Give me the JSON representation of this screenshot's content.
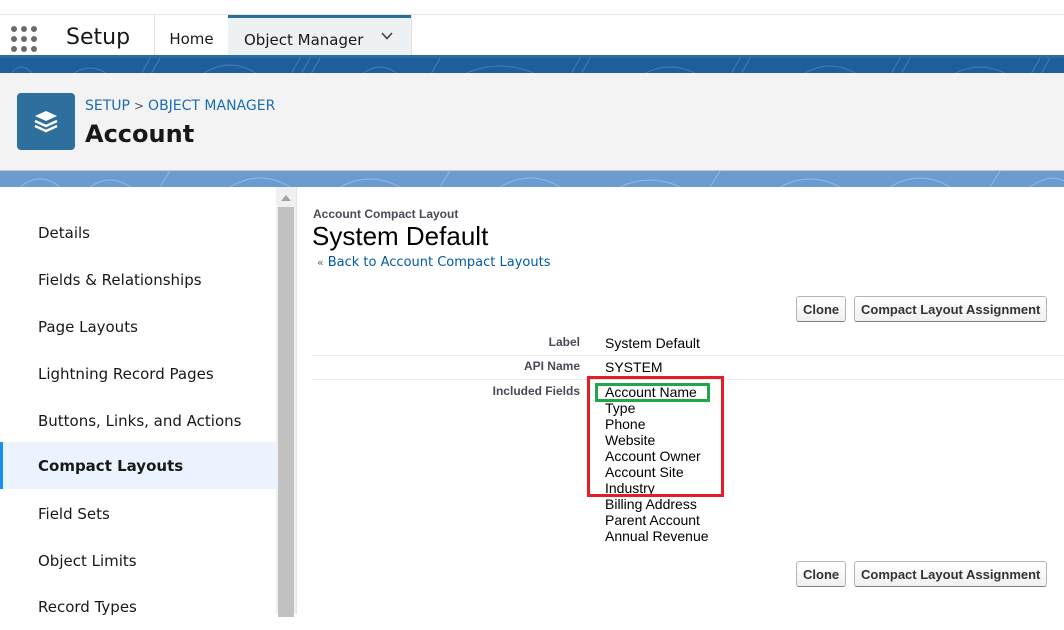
{
  "topnav": {
    "app_name": "Setup",
    "tabs": [
      {
        "label": "Home"
      },
      {
        "label": "Object Manager"
      }
    ],
    "icons": {
      "app_launcher": "app-launcher-grid-icon",
      "tab_menu": "chevron-down-icon"
    }
  },
  "header": {
    "breadcrumb": [
      "SETUP",
      "OBJECT MANAGER"
    ],
    "breadcrumb_separator": ">",
    "title": "Account",
    "icon": "stacked-layers-icon",
    "icon_color": "#2e6f9e"
  },
  "sidebar": {
    "items": [
      {
        "label": "Details"
      },
      {
        "label": "Fields & Relationships"
      },
      {
        "label": "Page Layouts"
      },
      {
        "label": "Lightning Record Pages"
      },
      {
        "label": "Buttons, Links, and Actions"
      },
      {
        "label": "Compact Layouts",
        "active": true
      },
      {
        "label": "Field Sets"
      },
      {
        "label": "Object Limits"
      },
      {
        "label": "Record Types"
      }
    ],
    "active_color": "#1b8cf2"
  },
  "main": {
    "subtitle": "Account Compact Layout",
    "title": "System Default",
    "back_link_prefix": "«",
    "back_link": "Back to Account Compact Layouts",
    "buttons": {
      "clone": "Clone",
      "assignment": "Compact Layout Assignment"
    },
    "details": {
      "label_label": "Label",
      "label_value": "System Default",
      "api_label": "API Name",
      "api_value": "SYSTEM",
      "fields_label": "Included Fields",
      "fields": [
        "Account Name",
        "Type",
        "Phone",
        "Website",
        "Account Owner",
        "Account Site",
        "Industry",
        "Billing Address",
        "Parent Account",
        "Annual Revenue"
      ]
    },
    "annotations": {
      "red_box_color": "#e41e26",
      "green_box_color": "#1ea84a"
    }
  }
}
